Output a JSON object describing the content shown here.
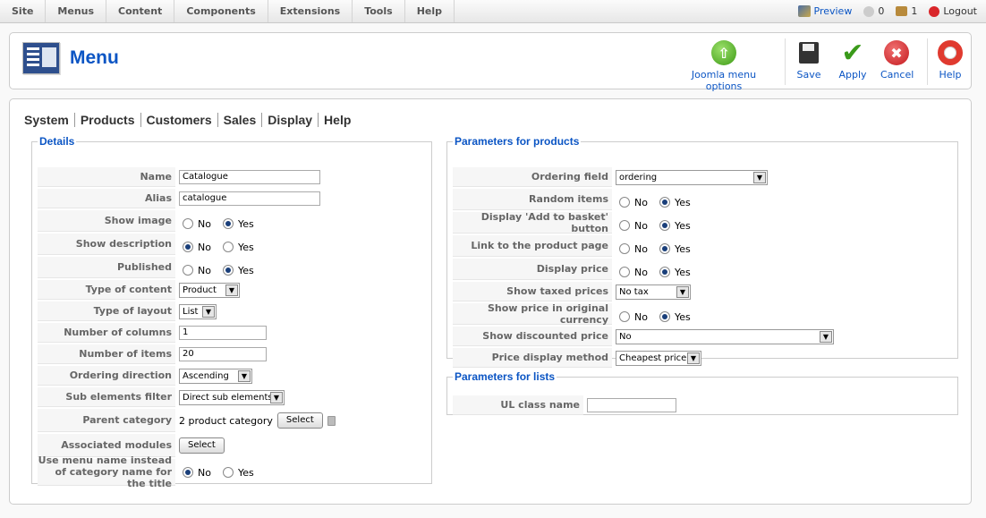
{
  "topmenu": [
    "Site",
    "Menus",
    "Content",
    "Components",
    "Extensions",
    "Tools",
    "Help"
  ],
  "status": {
    "preview": "Preview",
    "messages": "0",
    "users": "1",
    "logout": "Logout"
  },
  "toolbar": {
    "title": "Menu",
    "options": "Joomla menu options",
    "save": "Save",
    "apply": "Apply",
    "cancel": "Cancel",
    "help": "Help"
  },
  "tabs": [
    "System",
    "Products",
    "Customers",
    "Sales",
    "Display",
    "Help"
  ],
  "details": {
    "legend": "Details",
    "name_label": "Name",
    "name_value": "Catalogue",
    "alias_label": "Alias",
    "alias_value": "catalogue",
    "show_image_label": "Show image",
    "show_description_label": "Show description",
    "published_label": "Published",
    "type_content_label": "Type of content",
    "type_content_value": "Product",
    "type_layout_label": "Type of layout",
    "type_layout_value": "List",
    "columns_label": "Number of columns",
    "columns_value": "1",
    "items_label": "Number of items",
    "items_value": "20",
    "ordering_label": "Ordering direction",
    "ordering_value": "Ascending",
    "subfilter_label": "Sub elements filter",
    "subfilter_value": "Direct sub elements",
    "parent_label": "Parent category",
    "parent_value": "2 product category",
    "parent_button": "Select",
    "modules_label": "Associated modules",
    "modules_button": "Select",
    "menuname_label": "Use menu name instead of category name for the title",
    "no": "No",
    "yes": "Yes"
  },
  "products": {
    "legend": "Parameters for products",
    "ordering_field_label": "Ordering field",
    "ordering_field_value": "ordering",
    "random_label": "Random items",
    "basket_label": "Display 'Add to basket' button",
    "link_label": "Link to the product page",
    "price_label": "Display price",
    "taxed_label": "Show taxed prices",
    "taxed_value": "No tax",
    "orig_currency_label": "Show price in original currency",
    "discounted_label": "Show discounted price",
    "discounted_value": "No",
    "method_label": "Price display method",
    "method_value": "Cheapest price",
    "no": "No",
    "yes": "Yes"
  },
  "lists": {
    "legend": "Parameters for lists",
    "ul_label": "UL class name",
    "ul_value": ""
  },
  "colors": {
    "accent": "#0b55c4",
    "apply": "#3a9a1a",
    "cancel": "#d9262a",
    "options": "#5cb030"
  }
}
